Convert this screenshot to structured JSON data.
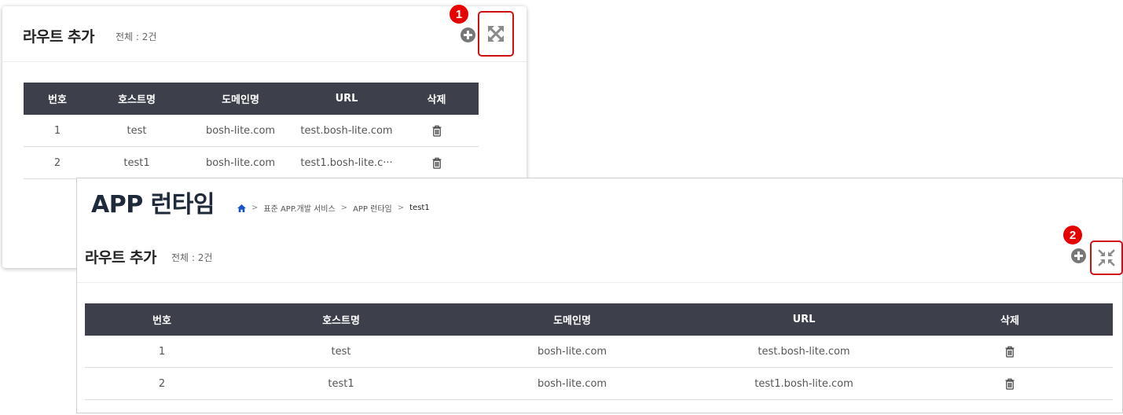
{
  "panel1": {
    "title": "라우트 추가",
    "count": "전체 : 2건",
    "badge": "1",
    "columns": [
      "번호",
      "호스트명",
      "도메인명",
      "URL",
      "삭제"
    ],
    "rows": [
      {
        "no": "1",
        "host": "test",
        "domain": "bosh-lite.com",
        "url": "test.bosh-lite.com"
      },
      {
        "no": "2",
        "host": "test1",
        "domain": "bosh-lite.com",
        "url": "test1.bosh-lite.c···"
      }
    ]
  },
  "panel2": {
    "page_title": "APP 런타임",
    "breadcrumb": [
      "표준 APP.개발 서비스",
      "APP 런타임",
      "test1"
    ],
    "title": "라우트 추가",
    "count": "전체 : 2건",
    "badge": "2",
    "columns": [
      "번호",
      "호스트명",
      "도메인명",
      "URL",
      "삭제"
    ],
    "rows": [
      {
        "no": "1",
        "host": "test",
        "domain": "bosh-lite.com",
        "url": "test.bosh-lite.com"
      },
      {
        "no": "2",
        "host": "test1",
        "domain": "bosh-lite.com",
        "url": "test1.bosh-lite.com"
      }
    ]
  },
  "icons": {
    "add": "plus-circle-icon",
    "expand": "expand-icon",
    "collapse": "collapse-icon",
    "delete": "trash-icon",
    "home": "home-icon"
  },
  "colors": {
    "table_header": "#3d404b",
    "highlight": "#d01010",
    "badge": "#e60000",
    "home_icon": "#1a56c9"
  }
}
